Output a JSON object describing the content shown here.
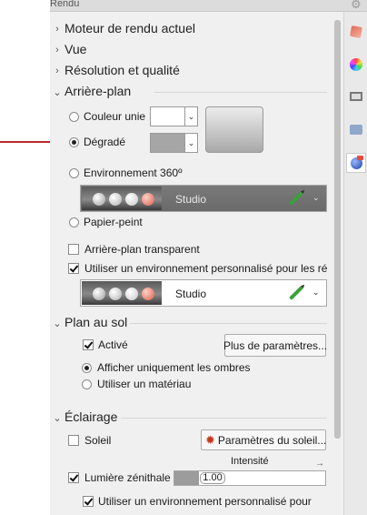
{
  "panel": {
    "title": "Rendu"
  },
  "sections": {
    "render_engine": "Moteur de rendu actuel",
    "view": "Vue",
    "resolution": "Résolution et qualité",
    "background": "Arrière-plan",
    "ground_plane": "Plan au sol",
    "lighting": "Éclairage"
  },
  "background": {
    "solid_color_label": "Couleur unie",
    "gradient_label": "Dégradé",
    "environment_label": "Environnement 360º",
    "wallpaper_label": "Papier-peint",
    "transparent_label": "Arrière-plan transparent",
    "custom_env_label": "Utiliser un environnement personnalisé pour les réf",
    "env_name": "Studio",
    "custom_env_name": "Studio",
    "selected": "gradient",
    "transparent_checked": false,
    "custom_env_checked": true,
    "solid_color": "#ffffff",
    "gradient_color": "#a6a6a6"
  },
  "ground_plane": {
    "enabled_label": "Activé",
    "enabled_checked": true,
    "more_params_label": "Plus de paramètres...",
    "shadows_only_label": "Afficher uniquement les ombres",
    "use_material_label": "Utiliser un matériau",
    "selected": "shadows_only"
  },
  "lighting": {
    "sun_label": "Soleil",
    "sun_checked": false,
    "sun_params_label": "Paramètres du soleil...",
    "intensity_label": "Intensité",
    "skylight_label": "Lumière zénithale",
    "skylight_checked": true,
    "skylight_intensity": "1.00",
    "skylight_fill": 0.16,
    "custom_env_label": "Utiliser un environnement personnalisé pour",
    "custom_env_checked": true
  },
  "colors": {
    "accent_arrow": "#c0272d"
  }
}
